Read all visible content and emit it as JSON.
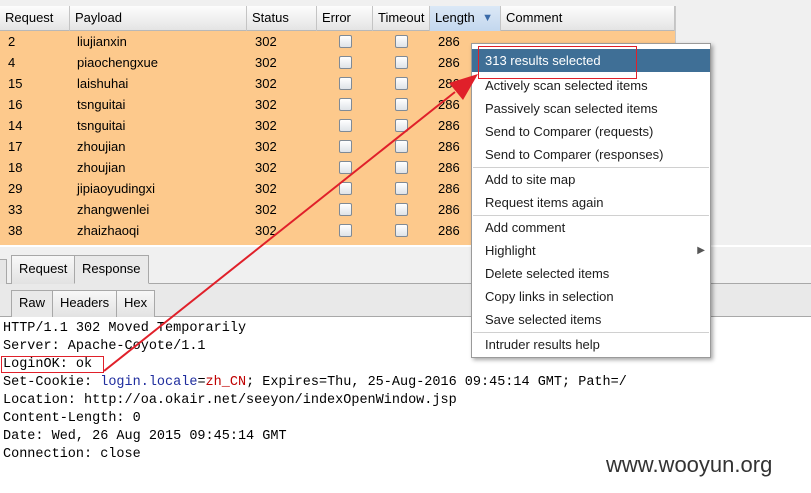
{
  "table": {
    "columns": [
      "Request",
      "Payload",
      "Status",
      "Error",
      "Timeout",
      "Length",
      "Comment"
    ],
    "sort_column": "Length",
    "sort_icon": "sort-descending-icon",
    "rows": [
      {
        "request": "2",
        "payload": "liujianxin",
        "status": "302",
        "length": "286"
      },
      {
        "request": "4",
        "payload": "piaochengxue",
        "status": "302",
        "length": "286"
      },
      {
        "request": "15",
        "payload": "laishuhai",
        "status": "302",
        "length": "286"
      },
      {
        "request": "16",
        "payload": "tsnguitai",
        "status": "302",
        "length": "286"
      },
      {
        "request": "14",
        "payload": "tsnguitai",
        "status": "302",
        "length": "286"
      },
      {
        "request": "17",
        "payload": "zhoujian",
        "status": "302",
        "length": "286"
      },
      {
        "request": "18",
        "payload": "zhoujian",
        "status": "302",
        "length": "286"
      },
      {
        "request": "29",
        "payload": "jipiaoyudingxi",
        "status": "302",
        "length": "286"
      },
      {
        "request": "33",
        "payload": "zhangwenlei",
        "status": "302",
        "length": "286"
      },
      {
        "request": "38",
        "payload": "zhaizhaoqi",
        "status": "302",
        "length": "286"
      }
    ],
    "selected_row_color": "#fdc98c"
  },
  "tabs": {
    "request_label": "Request",
    "response_label": "Response",
    "active": "Response"
  },
  "view_tabs": {
    "raw": "Raw",
    "headers": "Headers",
    "hex": "Hex",
    "active": "Raw"
  },
  "response": {
    "status_line": "HTTP/1.1 302 Moved Temporarily",
    "server": "Server: Apache-Coyote/1.1",
    "loginok": "LoginOK: ok",
    "cookie_prefix": "Set-Cookie: ",
    "cookie_name": "login.locale",
    "cookie_eq": "=",
    "cookie_value": "zh_CN",
    "cookie_rest": "; Expires=Thu, 25-Aug-2016 09:45:14 GMT; Path=/",
    "location": "Location: http://oa.okair.net/seeyon/indexOpenWindow.jsp",
    "content_length": "Content-Length: 0",
    "date": "Date: Wed, 26 Aug 2015 09:45:14 GMT",
    "connection": "Connection: close"
  },
  "context_menu": {
    "selection_count": "313 results selected",
    "items": [
      "Actively scan selected items",
      "Passively scan selected items",
      "Send to Comparer (requests)",
      "Send to Comparer (responses)",
      "Add to site map",
      "Request items again",
      "Add comment",
      "Highlight",
      "Delete selected items",
      "Copy links in selection",
      "Save selected items",
      "Intruder results help"
    ],
    "highlight_color": "#3f6f96"
  },
  "annotation_color": "#e0202a",
  "watermark": "www.wooyun.org"
}
